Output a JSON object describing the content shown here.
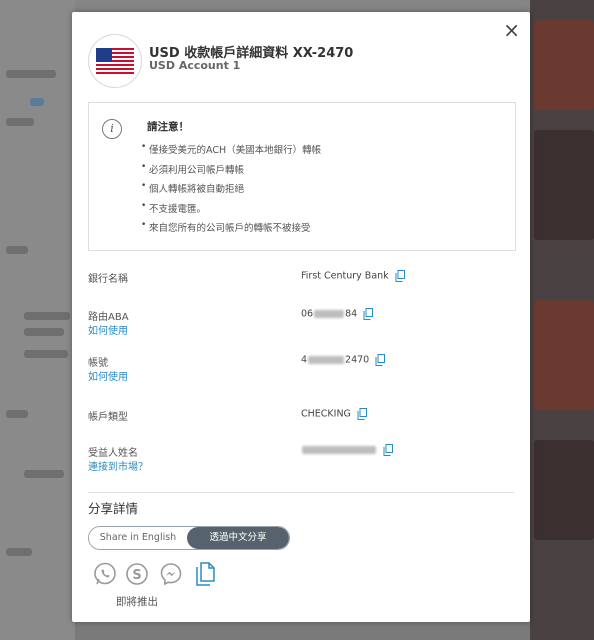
{
  "modal": {
    "close_glyph": "×",
    "title": "USD 收款帳戶詳細資料 XX-2470",
    "subtitle": "USD Account 1",
    "flag_icon": "us-flag-icon"
  },
  "notice": {
    "icon": "info-icon",
    "title": "請注意！",
    "items": [
      "僅接受美元的ACH（美國本地銀行）轉帳",
      "必須利用公司帳戶轉帳",
      "個人轉帳將被自動拒絕",
      "不支援電匯。",
      "來自您所有的公司帳戶的轉帳不被接受"
    ]
  },
  "details": {
    "bank_name": {
      "label": "銀行名稱",
      "value": "First Century Bank"
    },
    "routing": {
      "label": "路由ABA",
      "link": "如何使用",
      "value_prefix": "06",
      "value_suffix": "84"
    },
    "account": {
      "label": "帳號",
      "link": "如何使用",
      "value_prefix": "4",
      "value_suffix": "2470"
    },
    "account_type": {
      "label": "帳戶類型",
      "value": "CHECKING"
    },
    "beneficiary": {
      "label": "受益人姓名",
      "link": "連接到市場？"
    }
  },
  "share": {
    "heading": "分享詳情",
    "option_english": "Share in English",
    "option_chinese": "透過中文分享",
    "selected": "chinese",
    "icons": [
      "whatsapp-icon",
      "skype-icon",
      "messenger-icon",
      "copy-document-icon"
    ],
    "coming_soon": "即將推出"
  },
  "colors": {
    "link": "#2a8bc0",
    "toggle_active": "#56636e",
    "copy_icon": "#2a8bc0"
  }
}
